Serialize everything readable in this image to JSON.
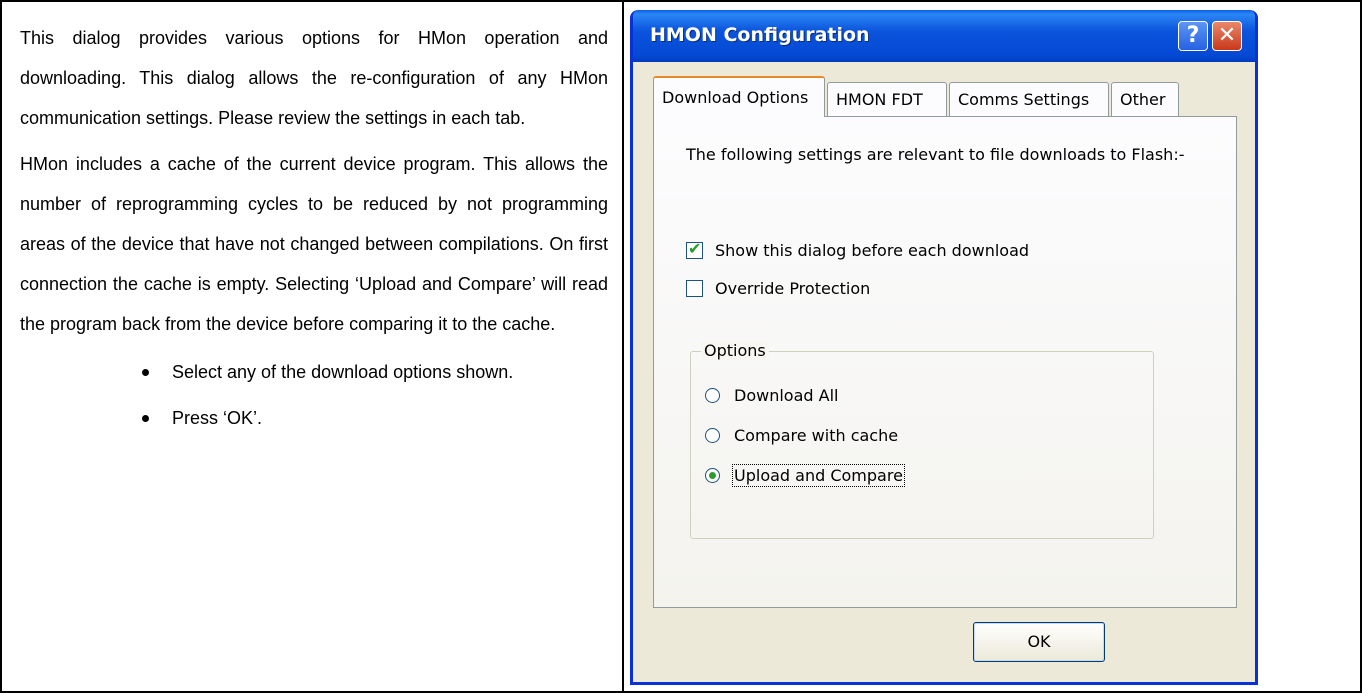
{
  "left_column": {
    "paragraph1": "This dialog provides various options for HMon operation and downloading. This dialog allows the re-configuration of any HMon communication settings. Please review the settings in each tab.",
    "paragraph2": "HMon includes a cache of the current device program. This allows the number of reprogramming cycles to be reduced by not programming areas of the device that have not changed between compilations. On first connection the cache is empty. Selecting ‘Upload and Compare’ will read the program back from the device before comparing it to the cache.",
    "bullets": [
      "Select any of the download options shown.",
      "Press ‘OK’."
    ]
  },
  "dialog": {
    "title": "HMON Configuration",
    "help_label": "?",
    "close_label": "✕",
    "tabs": [
      {
        "label": "Download Options",
        "active": true
      },
      {
        "label": "HMON FDT",
        "active": false
      },
      {
        "label": "Comms Settings",
        "active": false
      },
      {
        "label": "Other",
        "active": false
      }
    ],
    "intro_text": "The following settings are relevant to file downloads to Flash:-",
    "checkboxes": [
      {
        "label": "Show this dialog before each download",
        "checked": true
      },
      {
        "label": "Override Protection",
        "checked": false
      }
    ],
    "options_group": {
      "label": "Options",
      "radios": [
        {
          "label": "Download All",
          "selected": false
        },
        {
          "label": "Compare with cache",
          "selected": false
        },
        {
          "label": "Upload and Compare",
          "selected": true
        }
      ]
    },
    "ok_label": "OK"
  },
  "colors": {
    "titlebar": "#0b54dc",
    "dialog_bg": "#ece9d8",
    "close_button": "#c9381a"
  }
}
